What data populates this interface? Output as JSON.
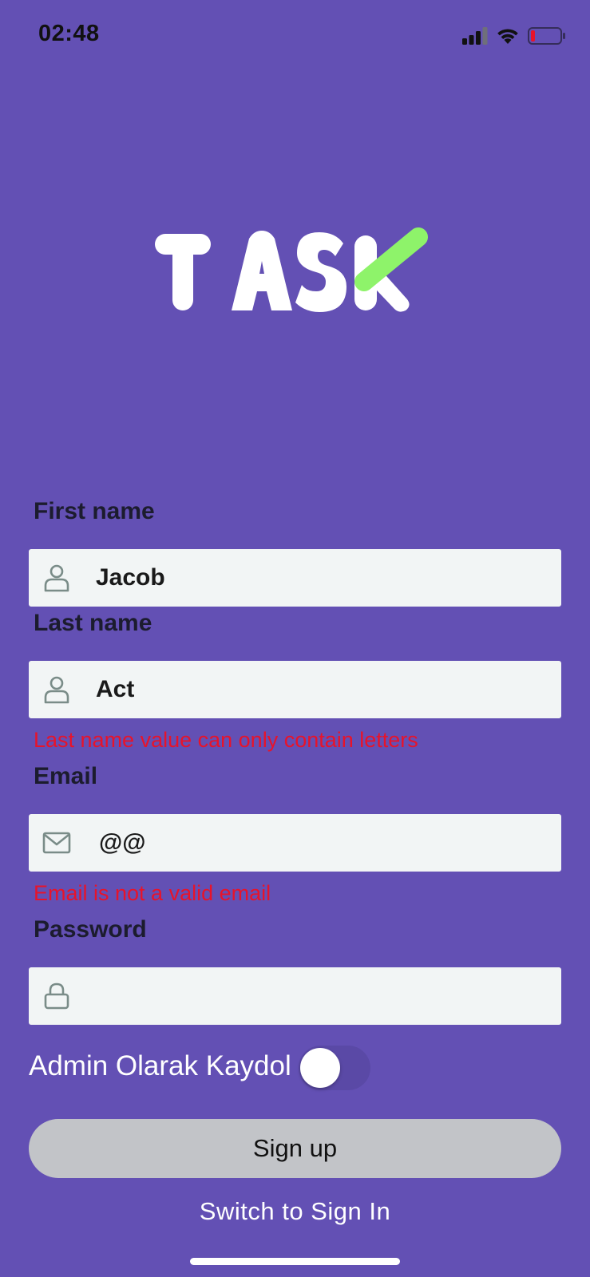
{
  "status_bar": {
    "time": "02:48",
    "icons": [
      "cellular-signal-icon",
      "wifi-icon",
      "battery-low-icon"
    ]
  },
  "logo": {
    "text": "TASK",
    "colors": {
      "letters": "#ffffff",
      "accent": "#8ef36a"
    }
  },
  "form": {
    "first_name": {
      "label": "First name",
      "value": "Jacob",
      "icon": "user-icon"
    },
    "last_name": {
      "label": "Last name",
      "value": "Act",
      "icon": "user-icon",
      "error": "Last name value can only contain letters"
    },
    "email": {
      "label": "Email",
      "value": "@@",
      "icon": "mail-icon",
      "error": "Email is not a valid email"
    },
    "password": {
      "label": "Password",
      "value": "",
      "icon": "lock-icon"
    },
    "admin_toggle": {
      "label": "Admin Olarak Kaydol",
      "checked": false
    },
    "signup_button": "Sign up",
    "switch_link": "Switch to Sign In"
  },
  "colors": {
    "background": "#6350b4",
    "field_background": "#f2f5f5",
    "error": "#e8132a",
    "button": "#c2c4c8"
  }
}
